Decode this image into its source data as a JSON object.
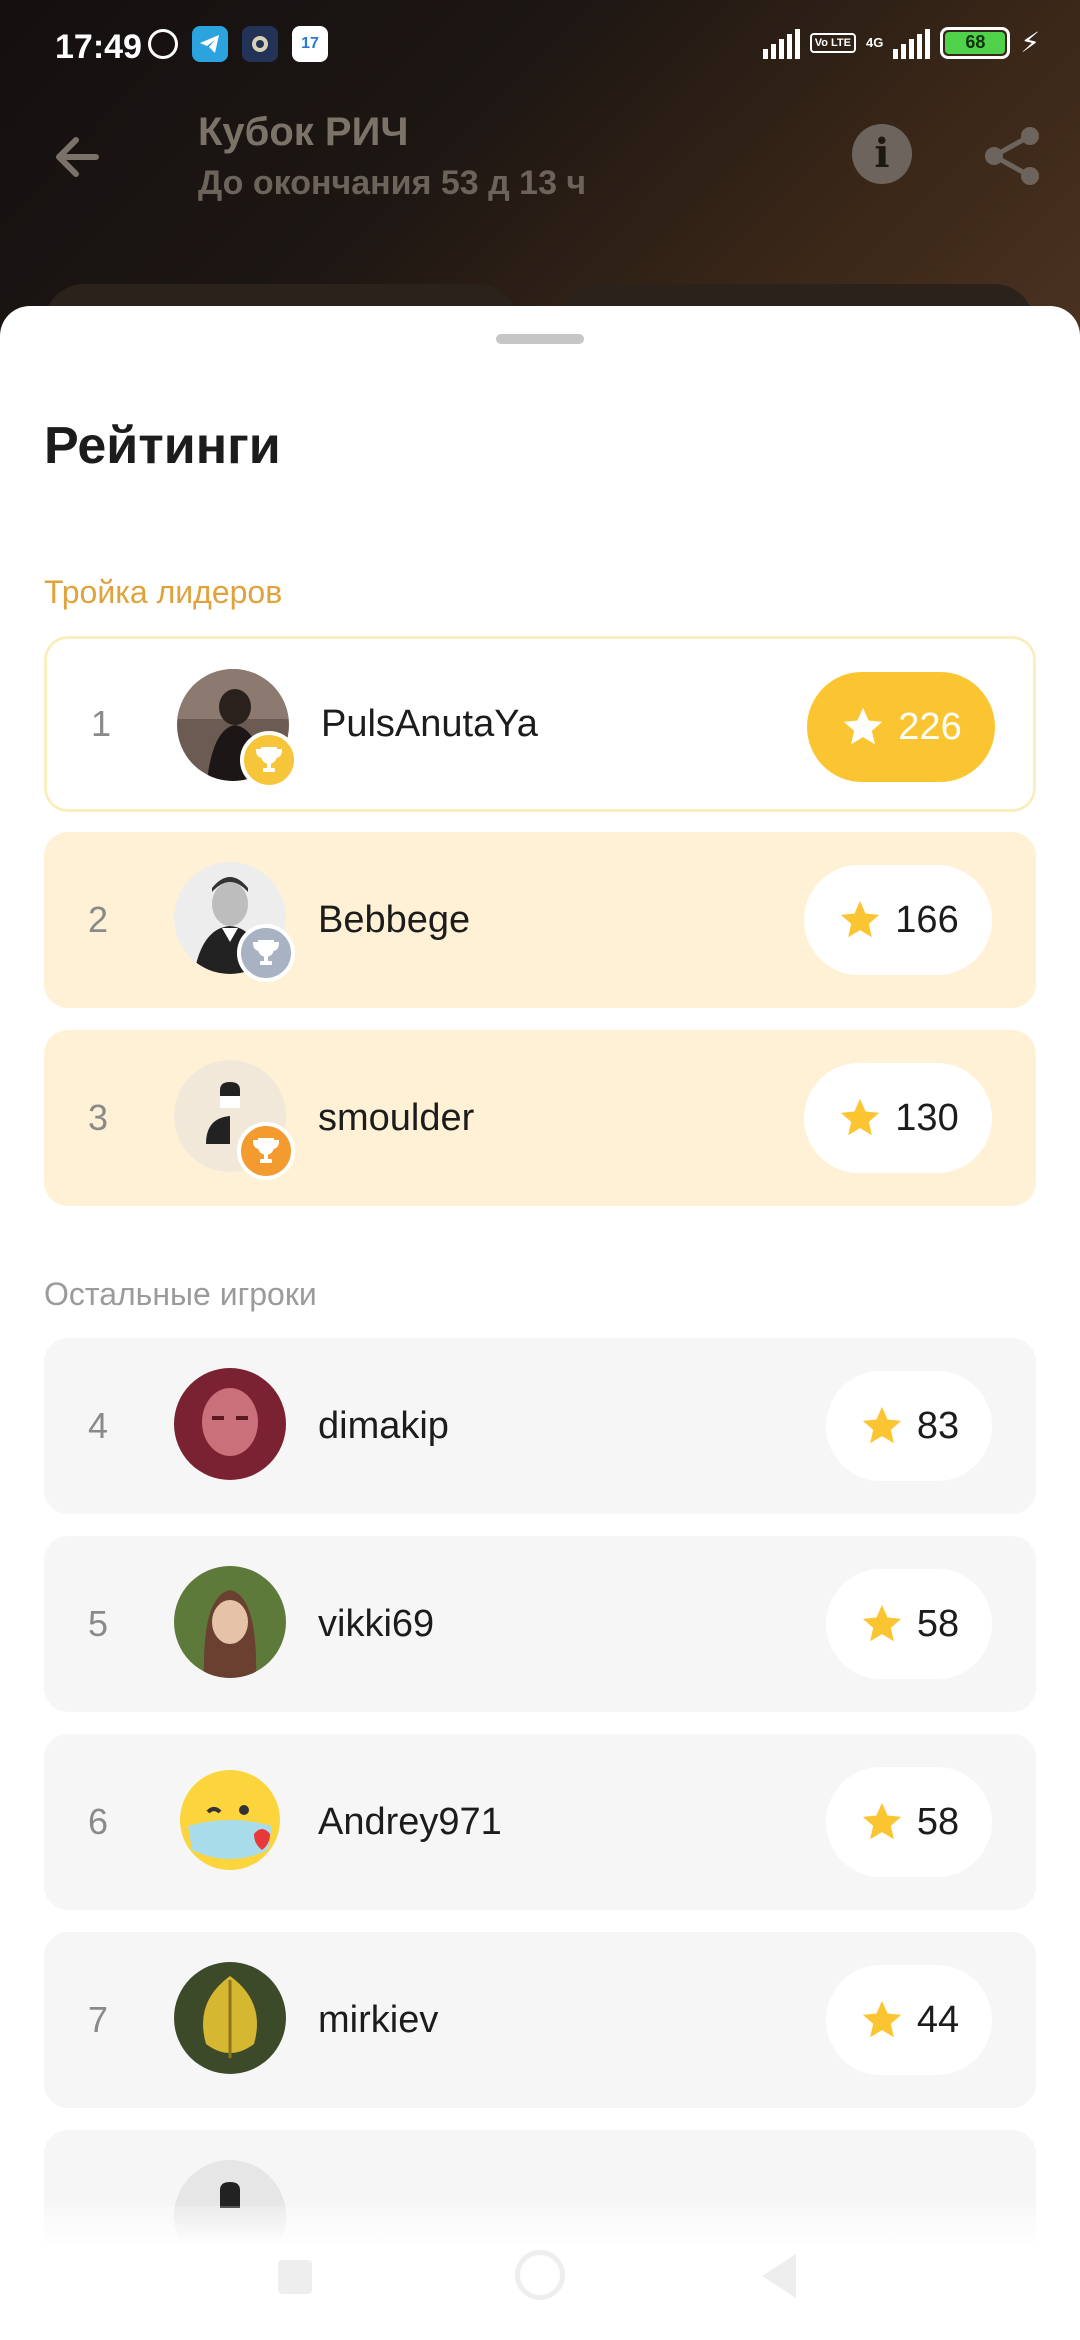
{
  "status_bar": {
    "time": "17:49",
    "calendar_day": "17",
    "volte": "Vo LTE",
    "network": "4G",
    "battery": "68"
  },
  "header": {
    "title": "Кубок РИЧ",
    "subtitle": "До окончания 53 д 13 ч"
  },
  "sheet": {
    "title": "Рейтинги",
    "leaders_label": "Тройка лидеров",
    "others_label": "Остальные игроки"
  },
  "leaders": [
    {
      "rank": "1",
      "name": "PulsAnutaYa",
      "score": "226",
      "trophy": "gold"
    },
    {
      "rank": "2",
      "name": "Bebbege",
      "score": "166",
      "trophy": "silver"
    },
    {
      "rank": "3",
      "name": "smoulder",
      "score": "130",
      "trophy": "bronze"
    }
  ],
  "others": [
    {
      "rank": "4",
      "name": "dimakip",
      "score": "83"
    },
    {
      "rank": "5",
      "name": "vikki69",
      "score": "58"
    },
    {
      "rank": "6",
      "name": "Andrey971",
      "score": "58"
    },
    {
      "rank": "7",
      "name": "mirkiev",
      "score": "44"
    }
  ],
  "colors": {
    "accent": "#fbc531",
    "leaders_label": "#e0a33c",
    "podium_bg": "#fff1d6"
  }
}
